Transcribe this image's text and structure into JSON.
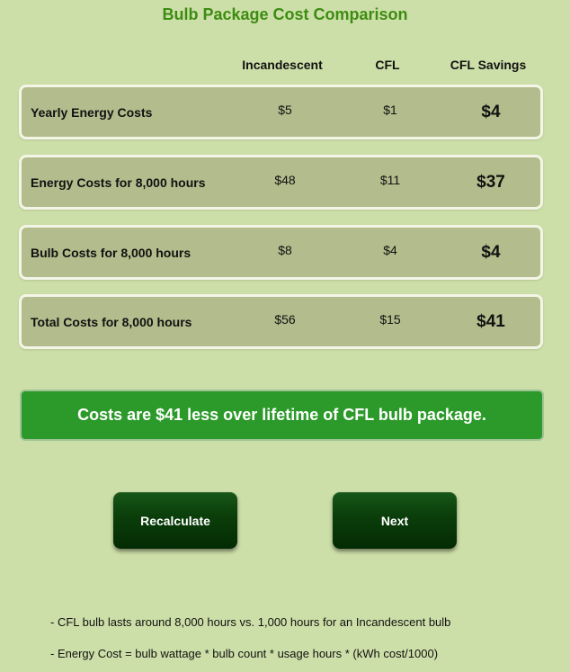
{
  "title": "Bulb Package Cost Comparison",
  "headers": {
    "incandescent": "Incandescent",
    "cfl": "CFL",
    "savings": "CFL Savings"
  },
  "rows": [
    {
      "label": "Yearly Energy Costs",
      "incandescent": "$5",
      "cfl": "$1",
      "savings": "$4"
    },
    {
      "label": "Energy Costs for 8,000 hours",
      "incandescent": "$48",
      "cfl": "$11",
      "savings": "$37"
    },
    {
      "label": "Bulb Costs for 8,000 hours",
      "incandescent": "$8",
      "cfl": "$4",
      "savings": "$4"
    },
    {
      "label": "Total Costs for 8,000 hours",
      "incandescent": "$56",
      "cfl": "$15",
      "savings": "$41"
    }
  ],
  "banner": "Costs are $41 less over lifetime of CFL bulb package.",
  "buttons": {
    "recalculate": "Recalculate",
    "next": "Next"
  },
  "notes": [
    "- CFL bulb lasts around 8,000 hours vs. 1,000 hours for an Incandescent bulb",
    "- Energy Cost = bulb wattage * bulb count * usage hours  * (kWh cost/1000)"
  ],
  "colors": {
    "background": "#cddfa8",
    "title": "#3d8c12",
    "row": "#b3bc8c",
    "banner": "#2c9a2a",
    "button": "#0b3f0b"
  }
}
